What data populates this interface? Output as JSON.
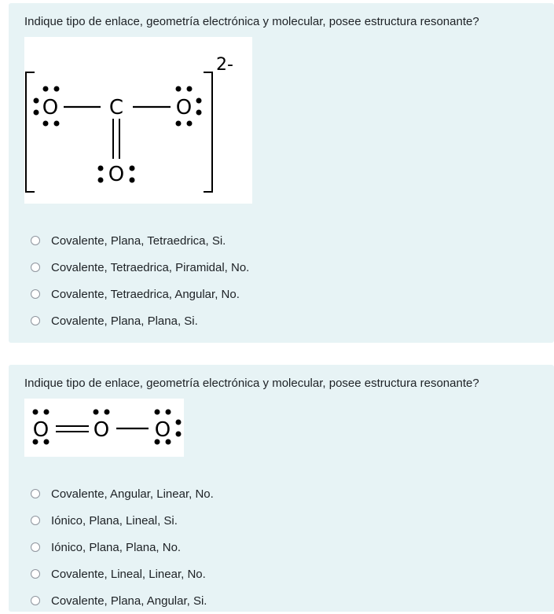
{
  "questions": [
    {
      "text": "Indique tipo de enlace, geometría electrónica y molecular, posee estructura resonante?",
      "figure": {
        "central_atom": "C",
        "outer_atom": "O",
        "charge": "2-"
      },
      "options": [
        "Covalente, Plana, Tetraedrica, Si.",
        "Covalente, Tetraedrica, Piramidal, No.",
        "Covalente, Tetraedrica, Angular, No.",
        "Covalente, Plana, Plana, Si."
      ]
    },
    {
      "text": "Indique tipo de enlace, geometría electrónica y molecular, posee estructura resonante?",
      "figure": {
        "atom": "O"
      },
      "options": [
        "Covalente, Angular, Linear, No.",
        "Iónico, Plana, Lineal, Si.",
        "Iónico, Plana, Plana, No.",
        "Covalente, Lineal, Linear, No.",
        "Covalente, Plana, Angular, Si."
      ]
    }
  ]
}
